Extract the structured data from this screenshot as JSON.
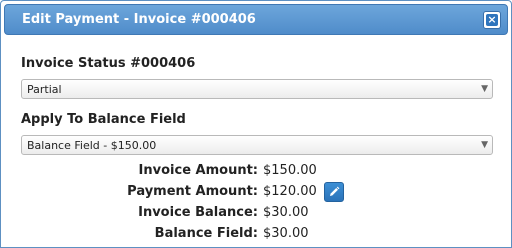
{
  "dialog": {
    "title": "Edit Payment - Invoice #000406",
    "close_icon": "close-icon"
  },
  "form": {
    "status_label": "Invoice Status #000406",
    "status_value": "Partial",
    "balance_label": "Apply To Balance Field",
    "balance_value": "Balance Field - $150.00"
  },
  "summary": {
    "invoice_amount_label": "Invoice Amount:",
    "invoice_amount_value": "$150.00",
    "payment_amount_label": "Payment Amount:",
    "payment_amount_value": "$120.00",
    "edit_icon": "pencil-icon",
    "invoice_balance_label": "Invoice Balance:",
    "invoice_balance_value": "$30.00",
    "balance_field_label": "Balance Field:",
    "balance_field_value": "$30.00"
  }
}
